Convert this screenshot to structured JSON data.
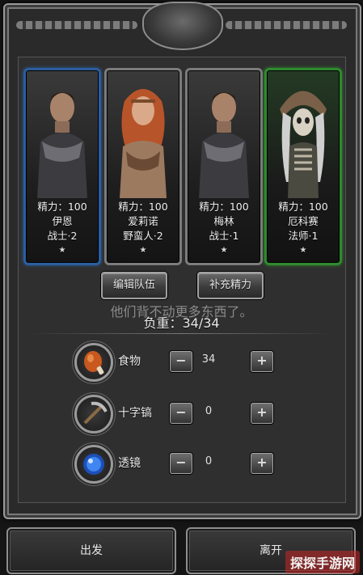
{
  "heroes": [
    {
      "energy": "精力：100",
      "name": "伊恩",
      "class": "战士·2",
      "star": "★",
      "border": "#2b5e9e",
      "figure": "man"
    },
    {
      "energy": "精力：100",
      "name": "爱莉诺",
      "class": "野蛮人·2",
      "star": "★",
      "border": "#7c7c7c",
      "figure": "woman"
    },
    {
      "energy": "精力：100",
      "name": "梅林",
      "class": "战士·1",
      "star": "★",
      "border": "#7c7c7c",
      "figure": "man"
    },
    {
      "energy": "精力：100",
      "name": "厄科赛",
      "class": "法师·1",
      "star": "★",
      "border": "#2f8a2f",
      "figure": "skeleton"
    }
  ],
  "buttons": {
    "edit_team": "编辑队伍",
    "replenish": "补充精力"
  },
  "hint_text": "他们背不动更多东西了。",
  "load": "负重：34/34",
  "items": [
    {
      "name": "食物",
      "qty": "34",
      "icon": "meat-icon"
    },
    {
      "name": "十字镐",
      "qty": "0",
      "icon": "pickaxe-icon"
    },
    {
      "name": "透镜",
      "qty": "0",
      "icon": "lens-icon"
    }
  ],
  "step": {
    "minus": "−",
    "plus": "+"
  },
  "bottom": {
    "depart": "出发",
    "leave": "离开"
  },
  "watermark": "探探手游网"
}
